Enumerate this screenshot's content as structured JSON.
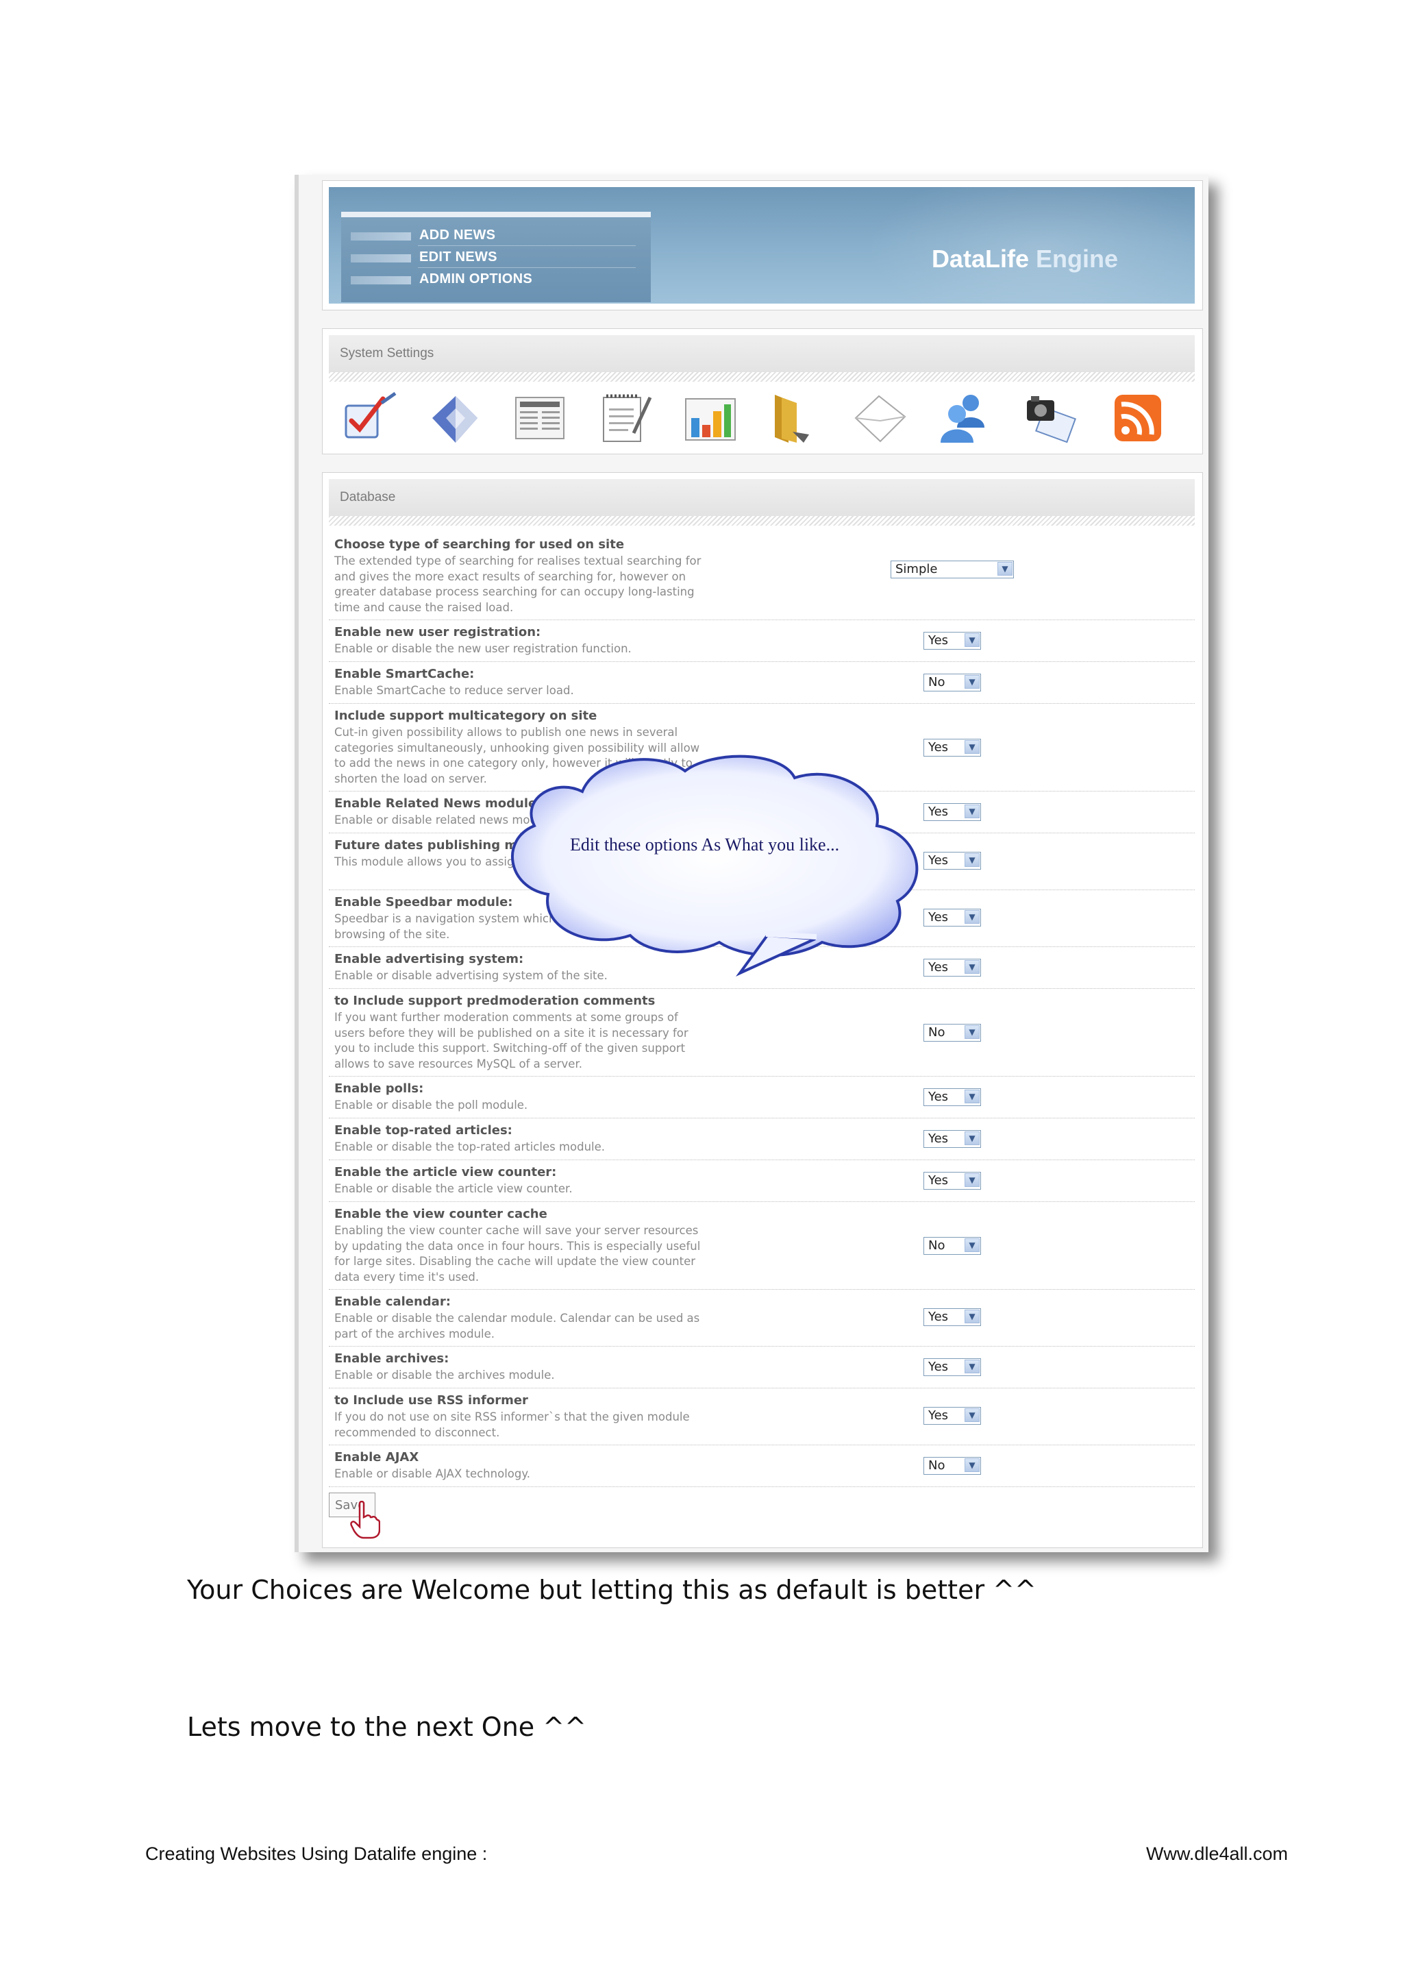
{
  "header": {
    "nav": [
      "ADD NEWS",
      "EDIT NEWS",
      "ADMIN OPTIONS"
    ],
    "brand_part1": "DataLife",
    "brand_part2": "Engine"
  },
  "system_settings": {
    "title": "System Settings",
    "icons": [
      "checklist-icon",
      "shield-icon",
      "newspaper-icon",
      "notepad-icon",
      "bar-chart-icon",
      "folder-icon",
      "envelope-icon",
      "users-icon",
      "camera-icon",
      "rss-icon"
    ],
    "icon_colors": {
      "rss": "#f26d21",
      "folder": "#e2b33b",
      "chart": "#3a8fd6"
    }
  },
  "database": {
    "title": "Database",
    "rows": [
      {
        "title": "Choose type of searching for used on site",
        "desc": "The extended type of searching for realises textual searching for and gives the more exact results of searching for, however on greater database process searching for can occupy long-lasting time and cause the raised load.",
        "value": "Simple"
      },
      {
        "title": "Enable new user registration:",
        "desc": "Enable or disable the new user registration function.",
        "value": "Yes"
      },
      {
        "title": "Enable SmartCache:",
        "desc": "Enable SmartCache to reduce server load.",
        "value": "No"
      },
      {
        "title": "Include support multicategory on site",
        "desc": "Cut-in given possibility allows to publish one news in several categories simultaneously, unhooking given possibility will allow to add the news in one category only, however it will greatly to shorten the load on server.",
        "value": "Yes"
      },
      {
        "title": "Enable Related News module:",
        "desc": "Enable or disable related news module.",
        "value": "Yes"
      },
      {
        "title": "Future dates publishing module:",
        "desc": "This module allows you to assign future dates to articles",
        "value": "Yes"
      },
      {
        "title": "Enable Speedbar module:",
        "desc": "Speedbar is a navigation system which helps to speed up browsing of the site.",
        "value": "Yes"
      },
      {
        "title": "Enable advertising system:",
        "desc": "Enable or disable advertising system of the site.",
        "value": "Yes"
      },
      {
        "title": "to Include support predmoderation comments",
        "desc": "If you want further moderation comments at some groups of users before they will be published on a site it is necessary for you to include this support. Switching-off of the given support allows to save resources MySQL of a server.",
        "value": "No"
      },
      {
        "title": "Enable polls:",
        "desc": "Enable or disable the poll module.",
        "value": "Yes"
      },
      {
        "title": "Enable top-rated articles:",
        "desc": "Enable or disable the top-rated articles module.",
        "value": "Yes"
      },
      {
        "title": "Enable the article view counter:",
        "desc": "Enable or disable the article view counter.",
        "value": "Yes"
      },
      {
        "title": "Enable the view counter cache",
        "desc": "Enabling the view counter cache will save your server resources by updating the data once in four hours. This is especially useful for large sites. Disabling the cache will update the view counter data every time it's used.",
        "value": "No"
      },
      {
        "title": "Enable calendar:",
        "desc": "Enable or disable the calendar module. Calendar can be used as part of the archives module.",
        "value": "Yes"
      },
      {
        "title": "Enable archives:",
        "desc": "Enable or disable the archives module.",
        "value": "Yes"
      },
      {
        "title": "to Include use RSS informer",
        "desc": "If you do not use on site RSS informer`s that the given module recommended to disconnect.",
        "value": "Yes"
      },
      {
        "title": "Enable AJAX",
        "desc": "Enable or disable AJAX technology.",
        "value": "No"
      }
    ],
    "save_label": "Save"
  },
  "callout": {
    "text": "Edit these options As What you like..."
  },
  "document": {
    "line1": "Your Choices are Welcome  but letting this as default is better ^^",
    "line2": "Lets move to the next One ^^",
    "footer_left": "Creating Websites Using Datalife engine :",
    "footer_right": "Www.dle4all.com"
  }
}
